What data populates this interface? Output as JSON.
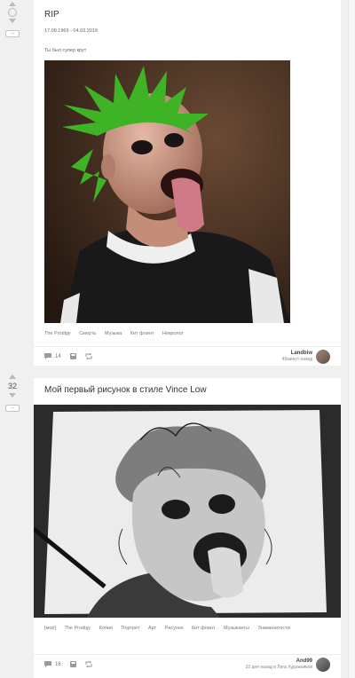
{
  "story1": {
    "title": "RIP",
    "dates": "17.08.1969 - 04.03.2019",
    "caption": "Ты был супер крут",
    "tags": [
      "The Prodigy",
      "Смерть",
      "Музыка",
      "Кит флинт",
      "Некролог"
    ],
    "comments": "14",
    "author": "Landbiw",
    "author_sub": "45минут назад"
  },
  "story2": {
    "rating": "32",
    "title": "Мой первый рисунок в стиле Vince Low",
    "tags": [
      "[моё]",
      "The Prodigy",
      "Копия",
      "Портрет",
      "Арт",
      "Рисунок",
      "Кит флинт",
      "Музыканты",
      "Знаменитости"
    ],
    "comments": "16",
    "author": "And99",
    "author_sub": "32 дня назад в Лига Художников"
  },
  "colors": {
    "hair": "#3fb326",
    "card": "#ffffff",
    "background": "#f0f0f0"
  }
}
